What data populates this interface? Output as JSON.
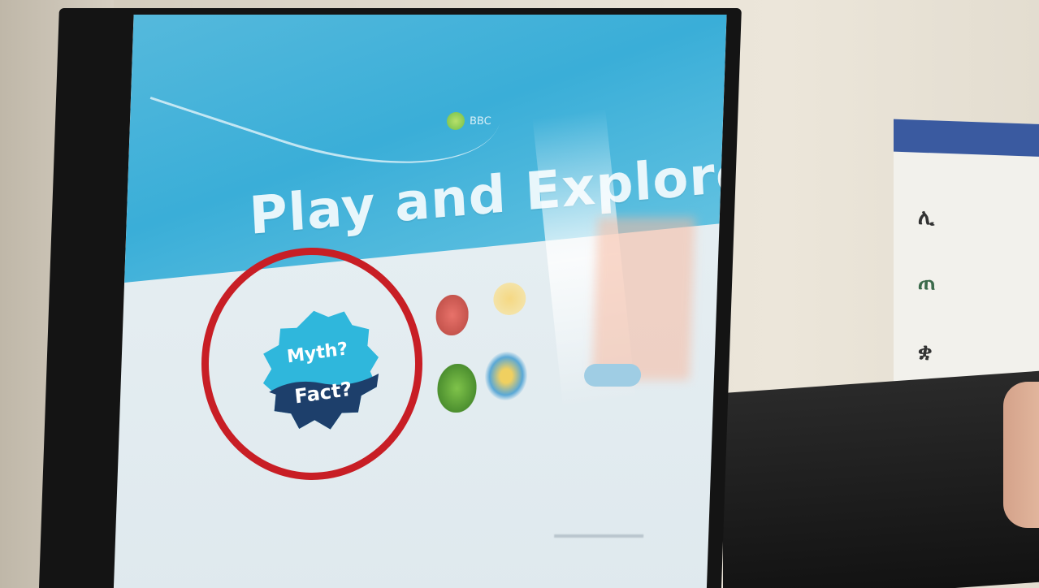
{
  "screen": {
    "logo_text": "BBC",
    "hero_title": "Play and Explore",
    "badge_top": "Myth?",
    "badge_bottom": "Fact?"
  },
  "colors": {
    "hero_blue": "#3aaed8",
    "badge_light": "#2fb7dc",
    "badge_dark": "#1d3f6b",
    "annotation_red": "#c81e25"
  },
  "icons": [
    "book-icon",
    "plant-icon",
    "speaker-icon",
    "cloud-icon"
  ]
}
